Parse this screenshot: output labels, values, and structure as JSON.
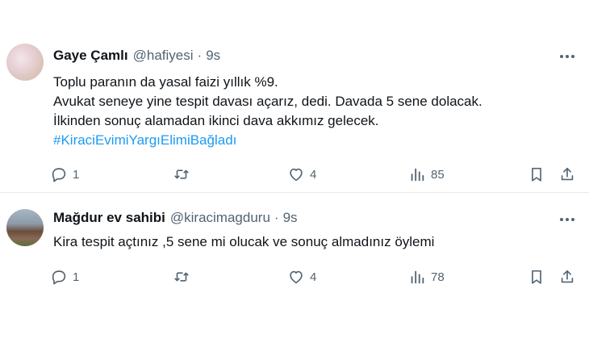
{
  "tweets": [
    {
      "author_name": "Gaye Çamlı",
      "handle": "@hafiyesi",
      "separator": "·",
      "time": "9s",
      "lines": [
        "Toplu paranın da yasal faizi yıllık %9.",
        "Avukat seneye yine tespit davası açarız, dedi. Davada 5 sene dolacak.",
        "İlkinden sonuç alamadan ikinci dava akkımız gelecek."
      ],
      "hashtag": "#KiraciEvimiYargıElimiBağladı",
      "replies": "1",
      "retweets": "",
      "likes": "4",
      "views": "85",
      "avatar_icon": "profile-photo"
    },
    {
      "author_name": "Mağdur ev sahibi",
      "handle": "@kiracimagduru",
      "separator": "·",
      "time": "9s",
      "lines": [
        "Kira tespit açtınız ,5 sene mi olucak ve sonuç almadınız öylemi"
      ],
      "replies": "1",
      "retweets": "",
      "likes": "4",
      "views": "78",
      "avatar_icon": "profile-photo"
    }
  ],
  "colors": {
    "text": "#0f1419",
    "secondary": "#536471",
    "link": "#1d9bf0",
    "divider": "#e6e9eb"
  },
  "icons": [
    "reply-icon",
    "retweet-icon",
    "like-icon",
    "views-icon",
    "bookmark-icon",
    "share-icon",
    "more-icon"
  ]
}
